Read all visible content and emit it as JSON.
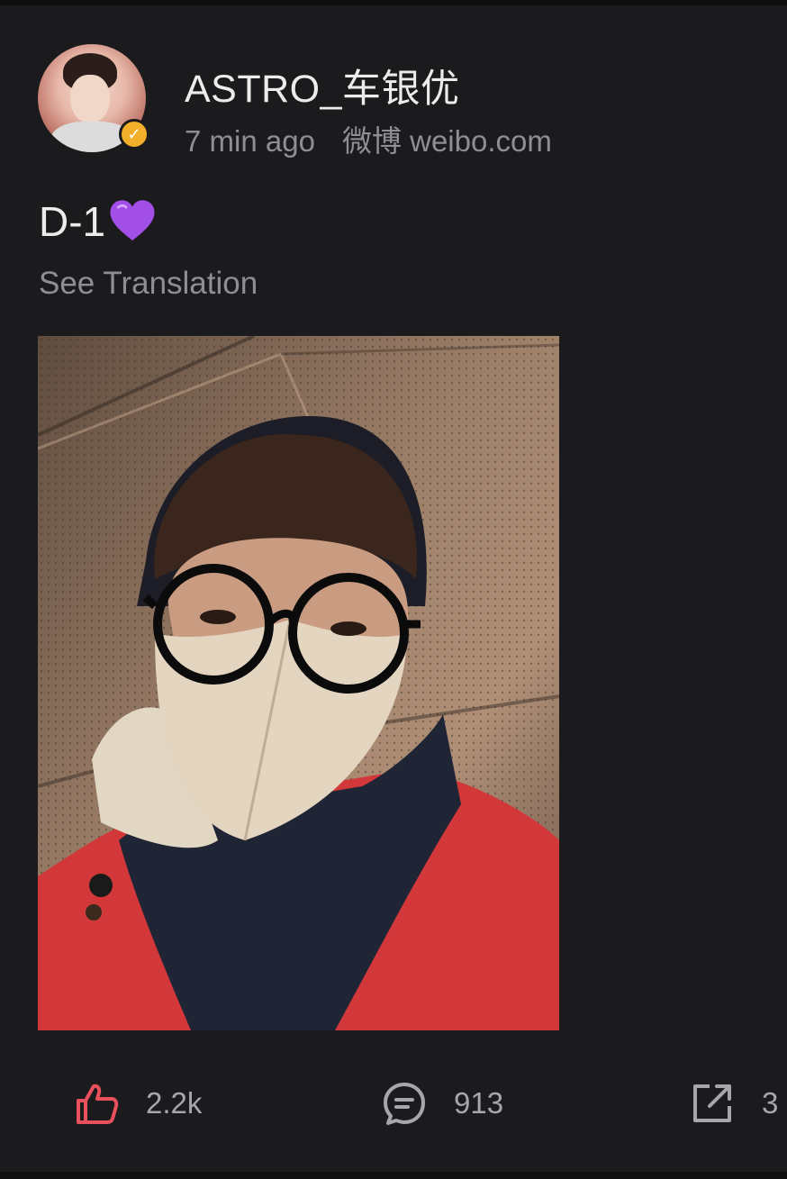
{
  "post": {
    "author": "ASTRO_车银优",
    "time": "7 min ago",
    "source": "微博 weibo.com",
    "verified": true,
    "verified_badge_color": "#f2b02a",
    "text": "D-1",
    "emoji": "purple-heart",
    "translate_label": "See Translation"
  },
  "actions": {
    "like_count": "2.2k",
    "comment_count": "913",
    "share_count": "3",
    "like_color": "#e8505b",
    "icon_color": "#a6a6ab"
  },
  "theme": {
    "background": "#1b1b1d",
    "text_primary": "#ececec",
    "text_secondary": "#8e8e93"
  }
}
